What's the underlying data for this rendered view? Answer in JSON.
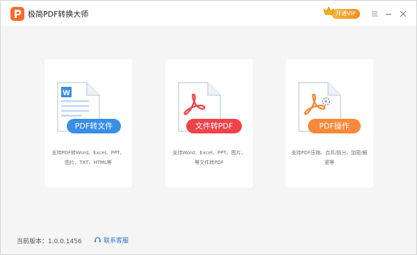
{
  "app": {
    "title": "极简PDF转换大师",
    "logo_icon": "app-logo-icon",
    "vip_label": "开通VIP",
    "accent": "#ff6a2b"
  },
  "cards": [
    {
      "button_label": "PDF转文件",
      "button_color": "#3a8ee6",
      "description": "支持PDF转Word、Excel、PPT、图片、TXT、HTML等",
      "icon": "word-document-icon"
    },
    {
      "button_label": "文件转PDF",
      "button_color": "#ee4349",
      "description": "支持Word、Excel、PPT、图片、等文件转PDF",
      "icon": "pdf-document-icon"
    },
    {
      "button_label": "PDF操作",
      "button_color": "#f6893a",
      "description": "支持PDF压缩、合并/拆分、加密/解密等",
      "icon": "pdf-settings-document-icon"
    }
  ],
  "footer": {
    "version": "当前版本：1.0.0.1456",
    "service_label": "联系客服"
  }
}
